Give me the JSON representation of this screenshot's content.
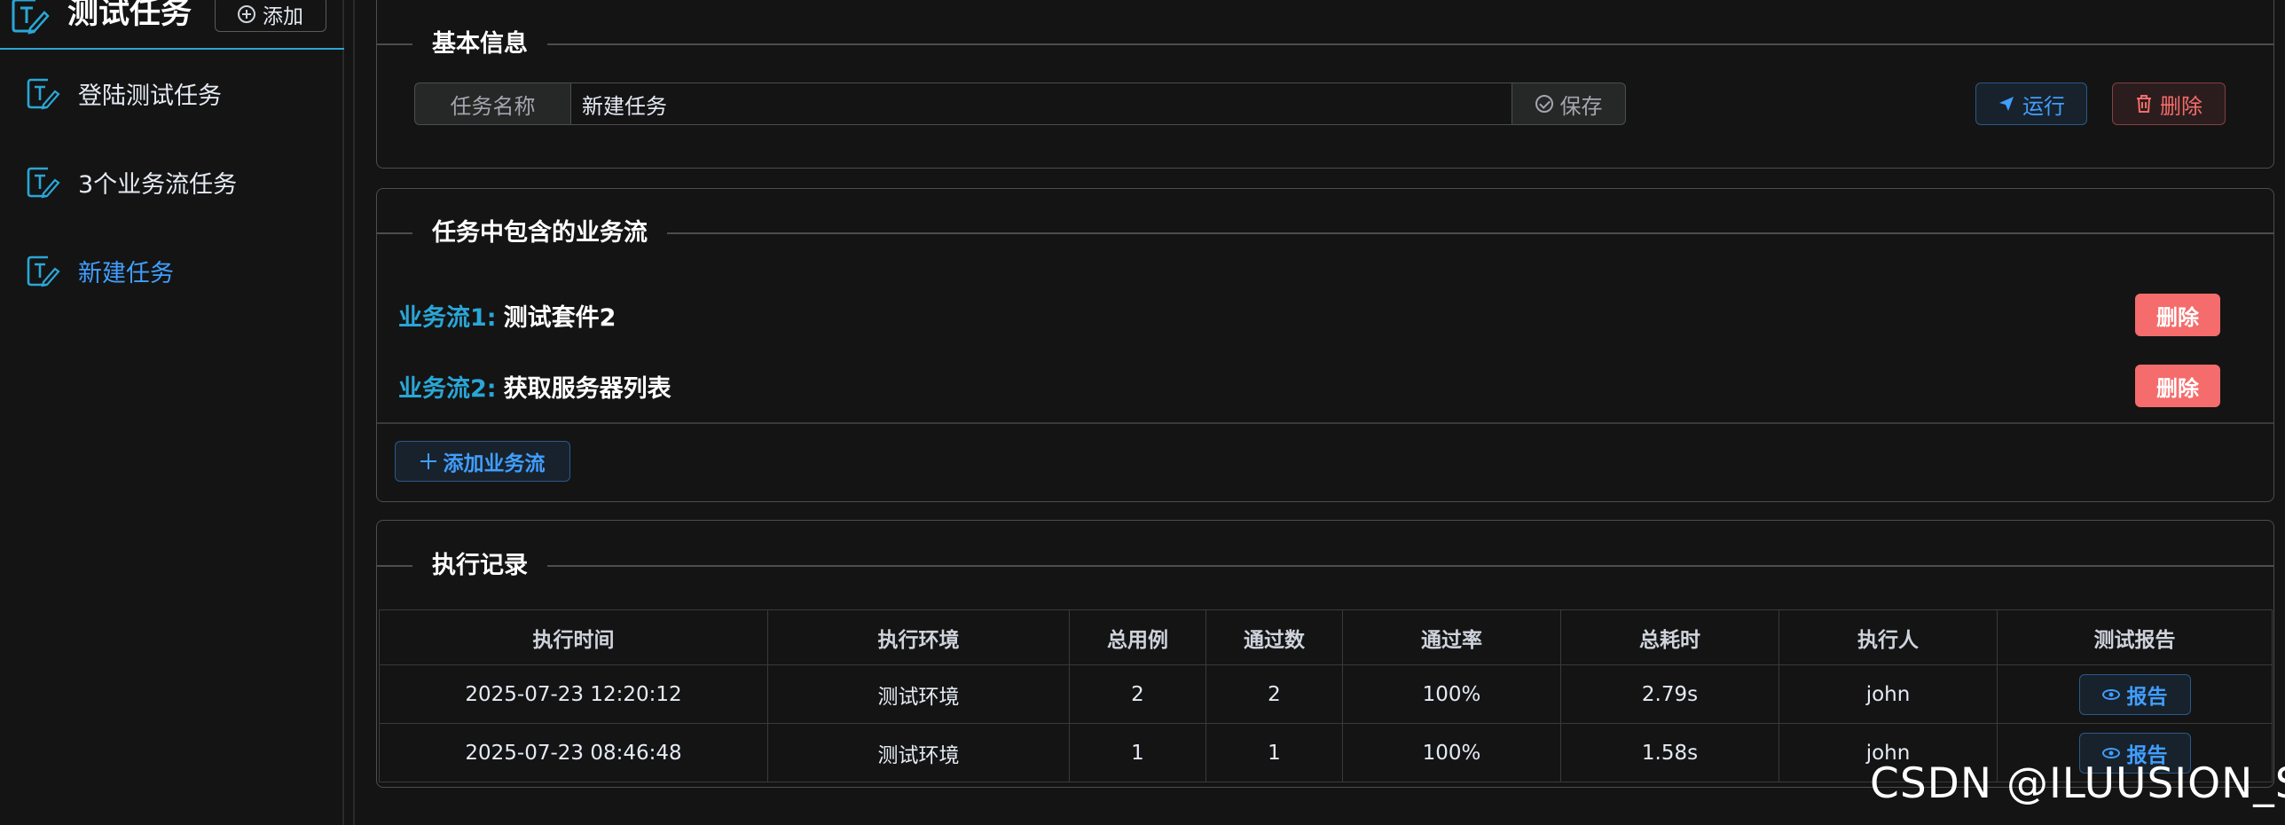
{
  "sidebar": {
    "title": "测试任务",
    "add_label": "添加",
    "items": [
      {
        "label": "登陆测试任务",
        "active": false
      },
      {
        "label": "3个业务流任务",
        "active": false
      },
      {
        "label": "新建任务",
        "active": true
      }
    ]
  },
  "basic_info": {
    "legend": "基本信息",
    "name_prefix": "任务名称",
    "name_value": "新建任务",
    "save_label": "保存",
    "run_label": "运行",
    "delete_label": "删除"
  },
  "flows": {
    "legend": "任务中包含的业务流",
    "items": [
      {
        "prefix": "业务流1:",
        "name": "测试套件2",
        "delete_label": "删除"
      },
      {
        "prefix": "业务流2:",
        "name": "获取服务器列表",
        "delete_label": "删除"
      }
    ],
    "add_label": "添加业务流"
  },
  "records": {
    "legend": "执行记录",
    "columns": [
      "执行时间",
      "执行环境",
      "总用例",
      "通过数",
      "通过率",
      "总耗时",
      "执行人",
      "测试报告"
    ],
    "rows": [
      {
        "time": "2025-07-23 12:20:12",
        "env": "测试环境",
        "total": "2",
        "passed": "2",
        "rate": "100%",
        "duration": "2.79s",
        "user": "john",
        "report_label": "报告"
      },
      {
        "time": "2025-07-23 08:46:48",
        "env": "测试环境",
        "total": "1",
        "passed": "1",
        "rate": "100%",
        "duration": "1.58s",
        "user": "john",
        "report_label": "报告"
      }
    ]
  },
  "watermark": "CSDN @ILUUSION_S",
  "colors": {
    "accent": "#409eff",
    "cyan": "#2aa6d6",
    "danger": "#f56c6c",
    "background": "#141414"
  }
}
